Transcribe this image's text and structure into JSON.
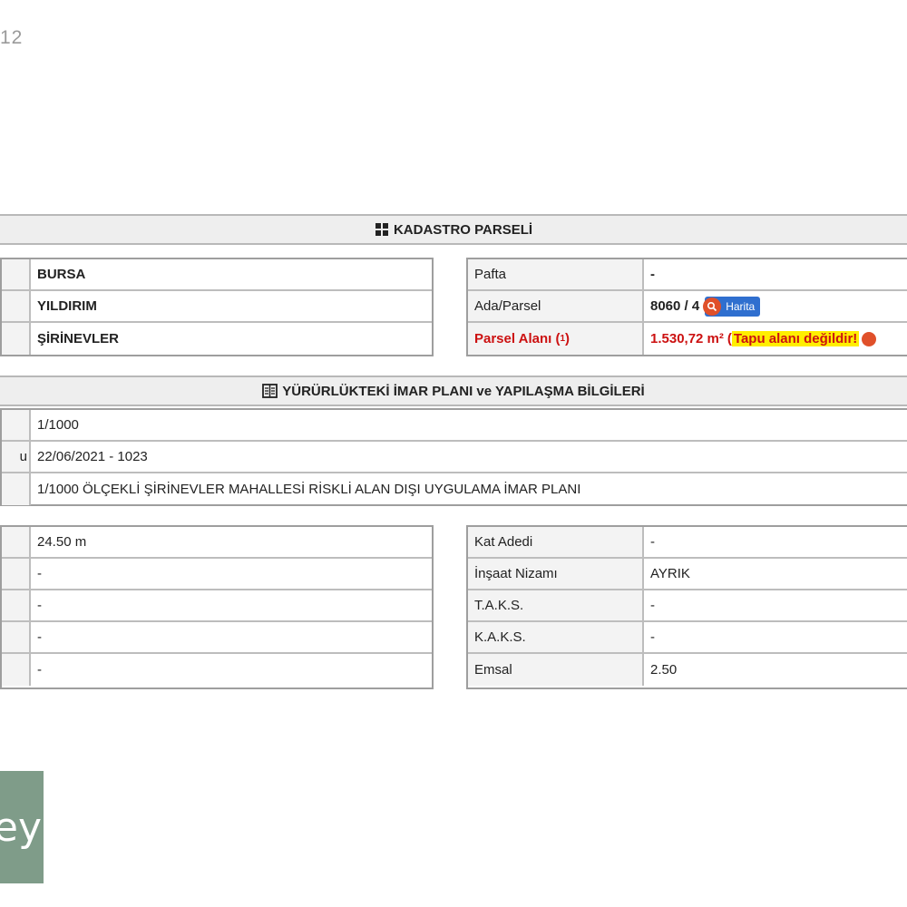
{
  "corner_text": "12",
  "kadastro": {
    "title": "KADASTRO PARSELİ",
    "left_values": [
      "BURSA",
      "YILDIRIM",
      "ŞİRİNEVLER"
    ],
    "pafta_label": "Pafta",
    "pafta_value": "-",
    "ada_label": "Ada/Parsel",
    "ada_value": "8060 / 4",
    "map_button": "Harita",
    "alan_label": "Parsel Alanı (",
    "alan_sup": "1",
    "alan_label_end": ")",
    "alan_value": "1.530,72 m²",
    "alan_note_open": "(",
    "alan_note": "Tapu alanı değildir!"
  },
  "imar": {
    "title": "YÜRÜRLÜKTEKİ İMAR PLANI ve YAPILAŞMA BİLGİLERİ",
    "partial_label": "u",
    "rows": [
      "1/1000",
      "22/06/2021 - 1023",
      "1/1000 ÖLÇEKLİ ŞİRİNEVLER MAHALLESİ RİSKLİ ALAN DIŞI UYGULAMA İMAR PLANI"
    ]
  },
  "yapi": {
    "left_values": [
      "24.50 m",
      "-",
      "-",
      "-",
      "-"
    ],
    "right_rows": [
      {
        "label": "Kat Adedi",
        "value": "-"
      },
      {
        "label": "İnşaat Nizamı",
        "value": "AYRIK"
      },
      {
        "label": "T.A.K.S.",
        "value": "-"
      },
      {
        "label": "K.A.K.S.",
        "value": "-"
      },
      {
        "label": "Emsal",
        "value": "2.50"
      }
    ]
  },
  "logo_text": "ey"
}
